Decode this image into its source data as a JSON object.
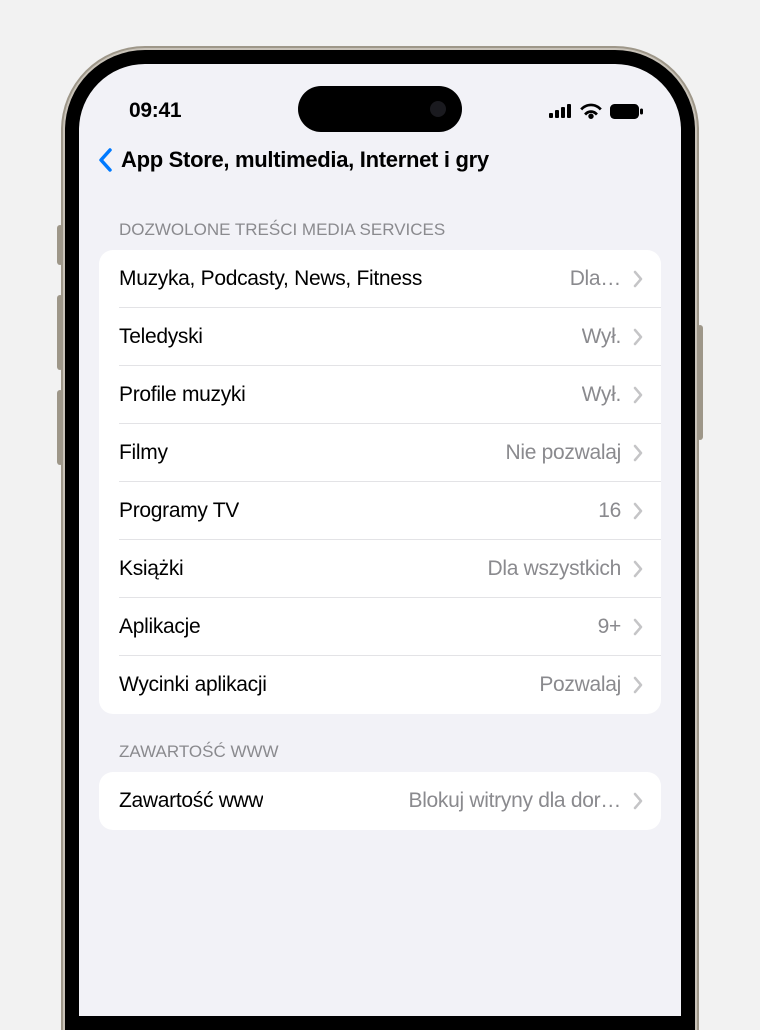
{
  "status": {
    "time": "09:41"
  },
  "nav": {
    "title": "App Store, multimedia, Internet i gry"
  },
  "section1": {
    "header": "DOZWOLONE TREŚCI MEDIA SERVICES",
    "rows": [
      {
        "label": "Muzyka, Podcasty, News, Fitness",
        "value": "Dla…"
      },
      {
        "label": "Teledyski",
        "value": "Wył."
      },
      {
        "label": "Profile muzyki",
        "value": "Wył."
      },
      {
        "label": "Filmy",
        "value": "Nie pozwalaj"
      },
      {
        "label": "Programy TV",
        "value": "16"
      },
      {
        "label": "Książki",
        "value": "Dla wszystkich"
      },
      {
        "label": "Aplikacje",
        "value": "9+"
      },
      {
        "label": "Wycinki aplikacji",
        "value": "Pozwalaj"
      }
    ]
  },
  "section2": {
    "header": "ZAWARTOŚĆ WWW",
    "rows": [
      {
        "label": "Zawartość www",
        "value": "Blokuj witryny dla dor…"
      }
    ]
  }
}
